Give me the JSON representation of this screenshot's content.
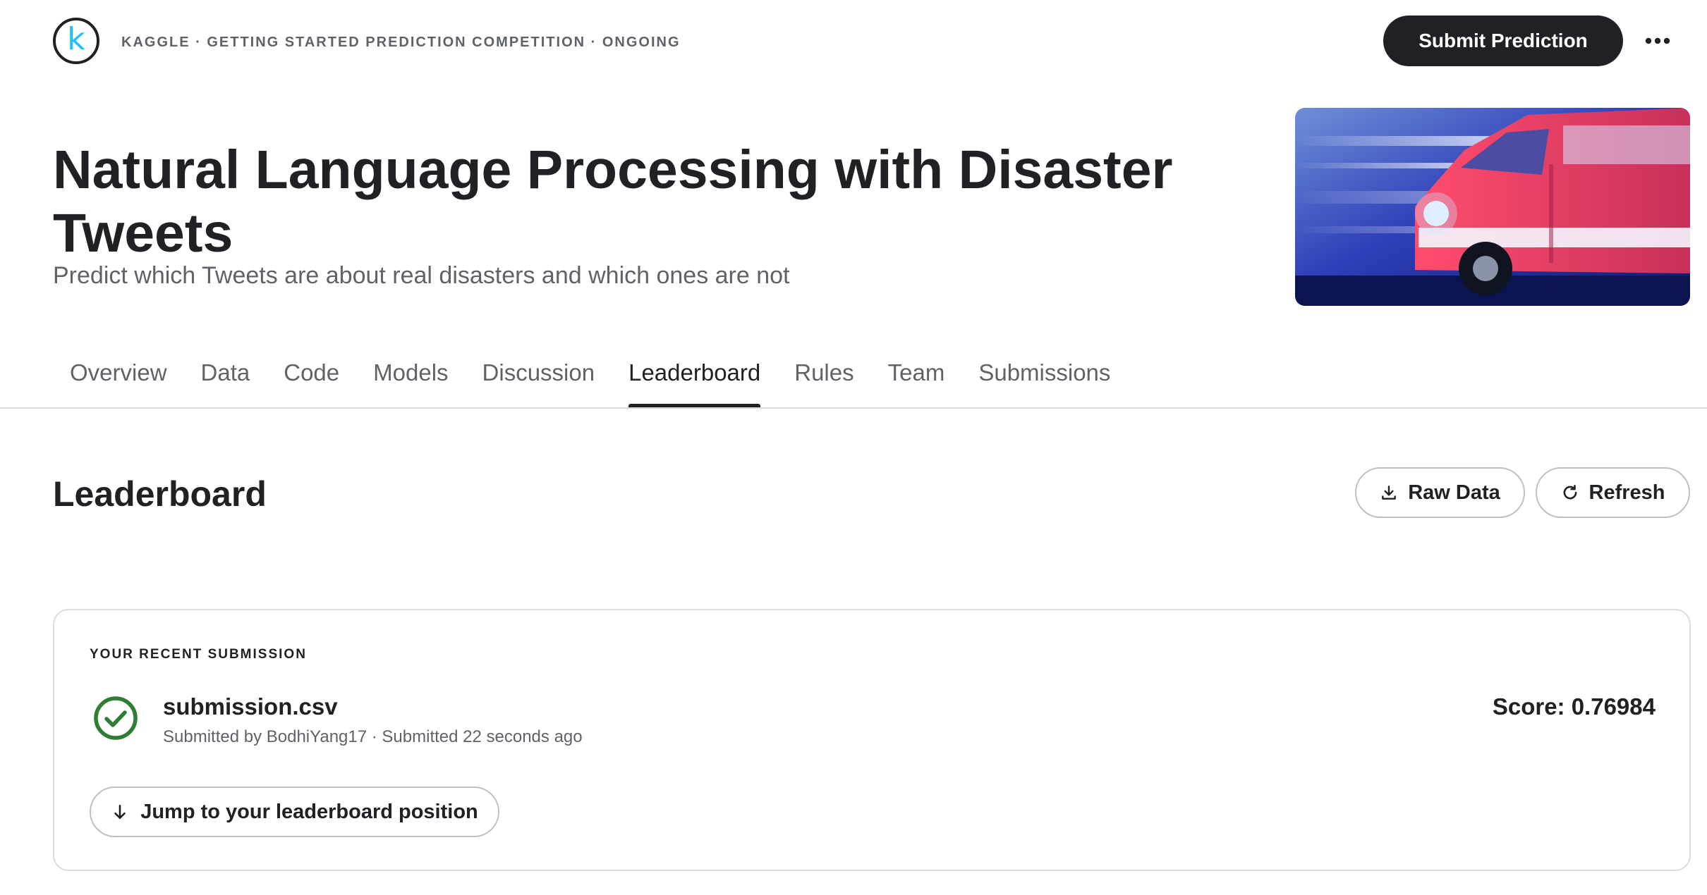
{
  "header": {
    "logo_letter": "k",
    "breadcrumb": "KAGGLE · GETTING STARTED PREDICTION COMPETITION · ONGOING",
    "submit_label": "Submit Prediction",
    "more_icon": "more-horizontal-icon"
  },
  "competition": {
    "title": "Natural Language Processing with Disaster Tweets",
    "subtitle": "Predict which Tweets are about real disasters and which ones are not",
    "hero_image": "ambulance-photo"
  },
  "tabs": [
    {
      "label": "Overview",
      "active": false
    },
    {
      "label": "Data",
      "active": false
    },
    {
      "label": "Code",
      "active": false
    },
    {
      "label": "Models",
      "active": false
    },
    {
      "label": "Discussion",
      "active": false
    },
    {
      "label": "Leaderboard",
      "active": true
    },
    {
      "label": "Rules",
      "active": false
    },
    {
      "label": "Team",
      "active": false
    },
    {
      "label": "Submissions",
      "active": false
    }
  ],
  "leaderboard": {
    "title": "Leaderboard",
    "raw_data_label": "Raw Data",
    "refresh_label": "Refresh"
  },
  "recent_submission": {
    "section_label": "YOUR RECENT SUBMISSION",
    "file_name": "submission.csv",
    "meta": "Submitted by BodhiYang17 · Submitted 22 seconds ago",
    "score": "Score: 0.76984",
    "status_icon": "check-circle-icon",
    "jump_label": "Jump to your leaderboard position"
  },
  "colors": {
    "text": "#202124",
    "muted": "#5f6368",
    "brand": "#20beff",
    "success": "#2e7d32",
    "border": "#dadce0"
  }
}
